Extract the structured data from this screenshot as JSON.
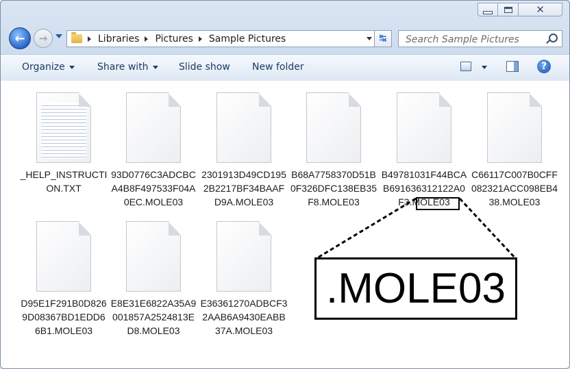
{
  "window": {
    "minimize_icon": "minimize-icon",
    "maximize_icon": "maximize-icon",
    "close_glyph": "✕"
  },
  "nav": {
    "back_glyph": "←",
    "forward_glyph": "→",
    "breadcrumb": [
      "Libraries",
      "Pictures",
      "Sample Pictures"
    ],
    "refresh_glyph": "↹",
    "search_placeholder": "Search Sample Pictures"
  },
  "toolbar": {
    "organize": "Organize",
    "share_with": "Share with",
    "slide_show": "Slide show",
    "new_folder": "New folder",
    "help_glyph": "?"
  },
  "files": [
    {
      "name": "_HELP_INSTRUCTION.TXT",
      "type": "txt"
    },
    {
      "name": "93D0776C3ADCBCA4B8F497533F04A0EC.MOLE03",
      "type": "blank"
    },
    {
      "name": "2301913D49CD1952B2217BF34BAAFD9A.MOLE03",
      "type": "blank"
    },
    {
      "name": "B68A7758370D51B0F326DFC138EB35F8.MOLE03",
      "type": "blank"
    },
    {
      "name": "B49781031F44BCAB691636312122A0F3.MOLE03",
      "type": "blank"
    },
    {
      "name": "C66117C007B0CFF082321ACC098EB438.MOLE03",
      "type": "blank"
    },
    {
      "name": "D95E1F291B0D8269D08367BD1EDD66B1.MOLE03",
      "type": "blank"
    },
    {
      "name": "E8E31E6822A35A9001857A2524813ED8.MOLE03",
      "type": "blank"
    },
    {
      "name": "E36361270ADBCF32AAB6A9430EABB37A.MOLE03",
      "type": "blank"
    }
  ],
  "callout": {
    "text": ".MOLE03"
  },
  "colors": {
    "toolbar_text": "#1e3b60",
    "window_border": "#7a8ea6",
    "accent_blue": "#2a66c9"
  }
}
